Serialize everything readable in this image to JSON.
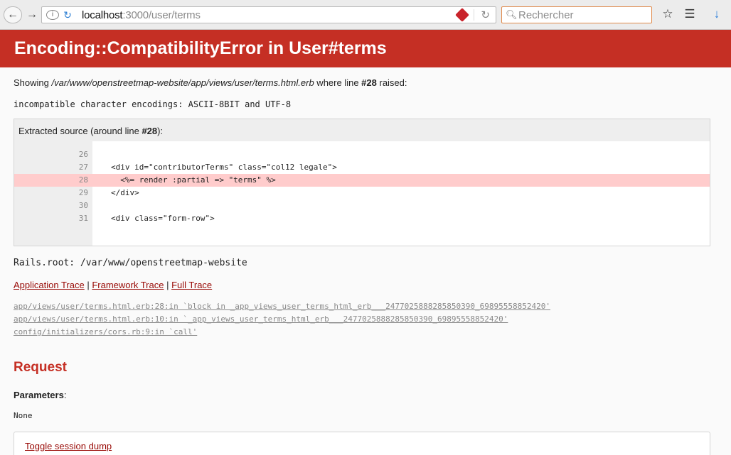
{
  "browser": {
    "url_host": "localhost",
    "url_rest": ":3000/user/terms",
    "search_placeholder": "Rechercher",
    "accent_color": "#e0894a"
  },
  "page": {
    "title": "Encoding::CompatibilityError in User#terms",
    "header_color": "#c52f24",
    "showing_prefix": "Showing ",
    "showing_path": "/var/www/openstreetmap-website/app/views/user/terms.html.erb",
    "showing_mid": " where line ",
    "showing_line": "#28",
    "showing_suffix": " raised:",
    "error_message": "incompatible character encodings: ASCII-8BIT and UTF-8",
    "source_head_prefix": "Extracted source (around line ",
    "source_head_line": "#28",
    "source_head_suffix": "):",
    "source_lines": [
      {
        "num": "26",
        "code": ""
      },
      {
        "num": "27",
        "code": "<div id=\"contributorTerms\" class=\"col12 legale\">"
      },
      {
        "num": "28",
        "code": "  <%= render :partial => \"terms\" %>"
      },
      {
        "num": "29",
        "code": "</div>"
      },
      {
        "num": "30",
        "code": ""
      },
      {
        "num": "31",
        "code": "<div class=\"form-row\">"
      }
    ],
    "rails_root": "Rails.root: /var/www/openstreetmap-website",
    "trace_links": {
      "application": "Application Trace",
      "framework": "Framework Trace",
      "full": "Full Trace",
      "separator": " | "
    },
    "trace": [
      "app/views/user/terms.html.erb:28:in `block in _app_views_user_terms_html_erb___2477025888285850390_69895558852420'",
      "app/views/user/terms.html.erb:10:in `_app_views_user_terms_html_erb___2477025888285850390_69895558852420'",
      "config/initializers/cors.rb:9:in `call'"
    ],
    "request_title": "Request",
    "params_label": "Parameters",
    "params_colon": ":",
    "params_value": "None",
    "toggle_session": "Toggle session dump"
  }
}
